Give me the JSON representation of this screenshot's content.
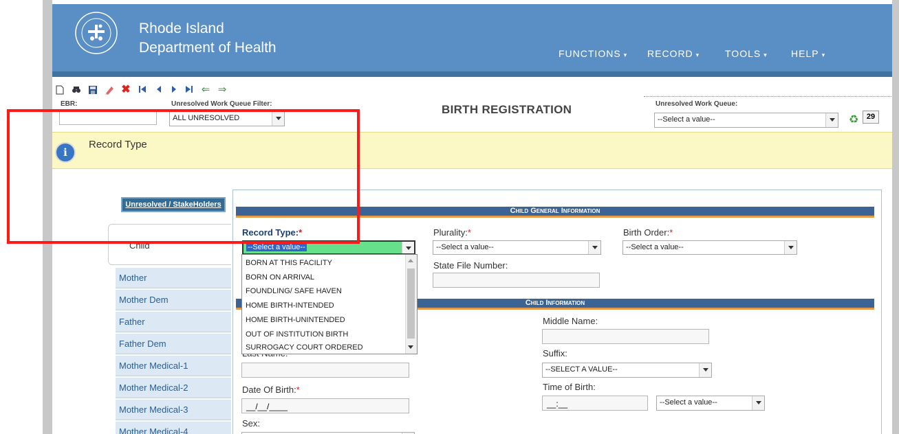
{
  "header": {
    "title_line1": "Rhode Island",
    "title_line2": "Department of Health",
    "nav": [
      "FUNCTIONS",
      "RECORD",
      "TOOLS",
      "HELP"
    ],
    "nav_caret": "▾"
  },
  "toolbar": {
    "icons": [
      "new-icon",
      "find-icon",
      "save-icon",
      "edit-icon",
      "delete-icon",
      "first-record-icon",
      "previous-record-icon",
      "next-record-icon",
      "last-record-icon",
      "back-arrow-icon",
      "forward-arrow-icon"
    ],
    "ebr_label": "EBR:",
    "ebr_value": "",
    "filter_label": "Unresolved Work Queue Filter:",
    "filter_value": "ALL UNRESOLVED",
    "page_title": "BIRTH REGISTRATION",
    "queue_label": "Unresolved Work Queue:",
    "queue_value": "--Select a value--",
    "queue_count": "29"
  },
  "info_bar": {
    "text": "Record Type"
  },
  "sidebar": {
    "stakeholders_button": "Unresolved / StakeHolders",
    "active_item": "Child",
    "items": [
      "Mother",
      "Mother Dem",
      "Father",
      "Father Dem",
      "Mother Medical-1",
      "Mother Medical-2",
      "Mother Medical-3",
      "Mother Medical-4"
    ]
  },
  "child_general": {
    "header": "Child General Information",
    "record_type_label": "Record Type:",
    "record_type_value": "--Select a value--",
    "plurality_label": "Plurality:",
    "plurality_value": "--Select a value--",
    "birth_order_label": "Birth Order:",
    "birth_order_value": "--Select a value--",
    "state_file_label": "State File Number:",
    "required_mark": "*"
  },
  "record_type_options": [
    "BORN AT THIS FACILITY",
    "BORN ON ARRIVAL",
    "FOUNDLING/ SAFE HAVEN",
    "HOME BIRTH-INTENDED",
    "HOME BIRTH-UNINTENDED",
    "OUT OF INSTITUTION BIRTH",
    "SURROGACY COURT ORDERED"
  ],
  "child_info": {
    "header": "Child Information",
    "middle_name_label": "Middle Name:",
    "last_name_label": "Last Name:",
    "suffix_label": "Suffix:",
    "suffix_value": "--SELECT A VALUE--",
    "dob_label": "Date Of Birth:",
    "dob_mask": "__/__/____",
    "time_label": "Time of Birth:",
    "time_mask": "__:__",
    "time_select": "--Select a value--",
    "sex_label": "Sex:"
  },
  "colors": {
    "header_blue": "#5a8fc6",
    "section_header": "#3b6393",
    "section_accent": "#e49a46",
    "info_bar": "#fcf8c6",
    "required": "#d21f1f",
    "annotation_box": "#ff1a1a",
    "selected_select_bg": "#66e08a"
  }
}
